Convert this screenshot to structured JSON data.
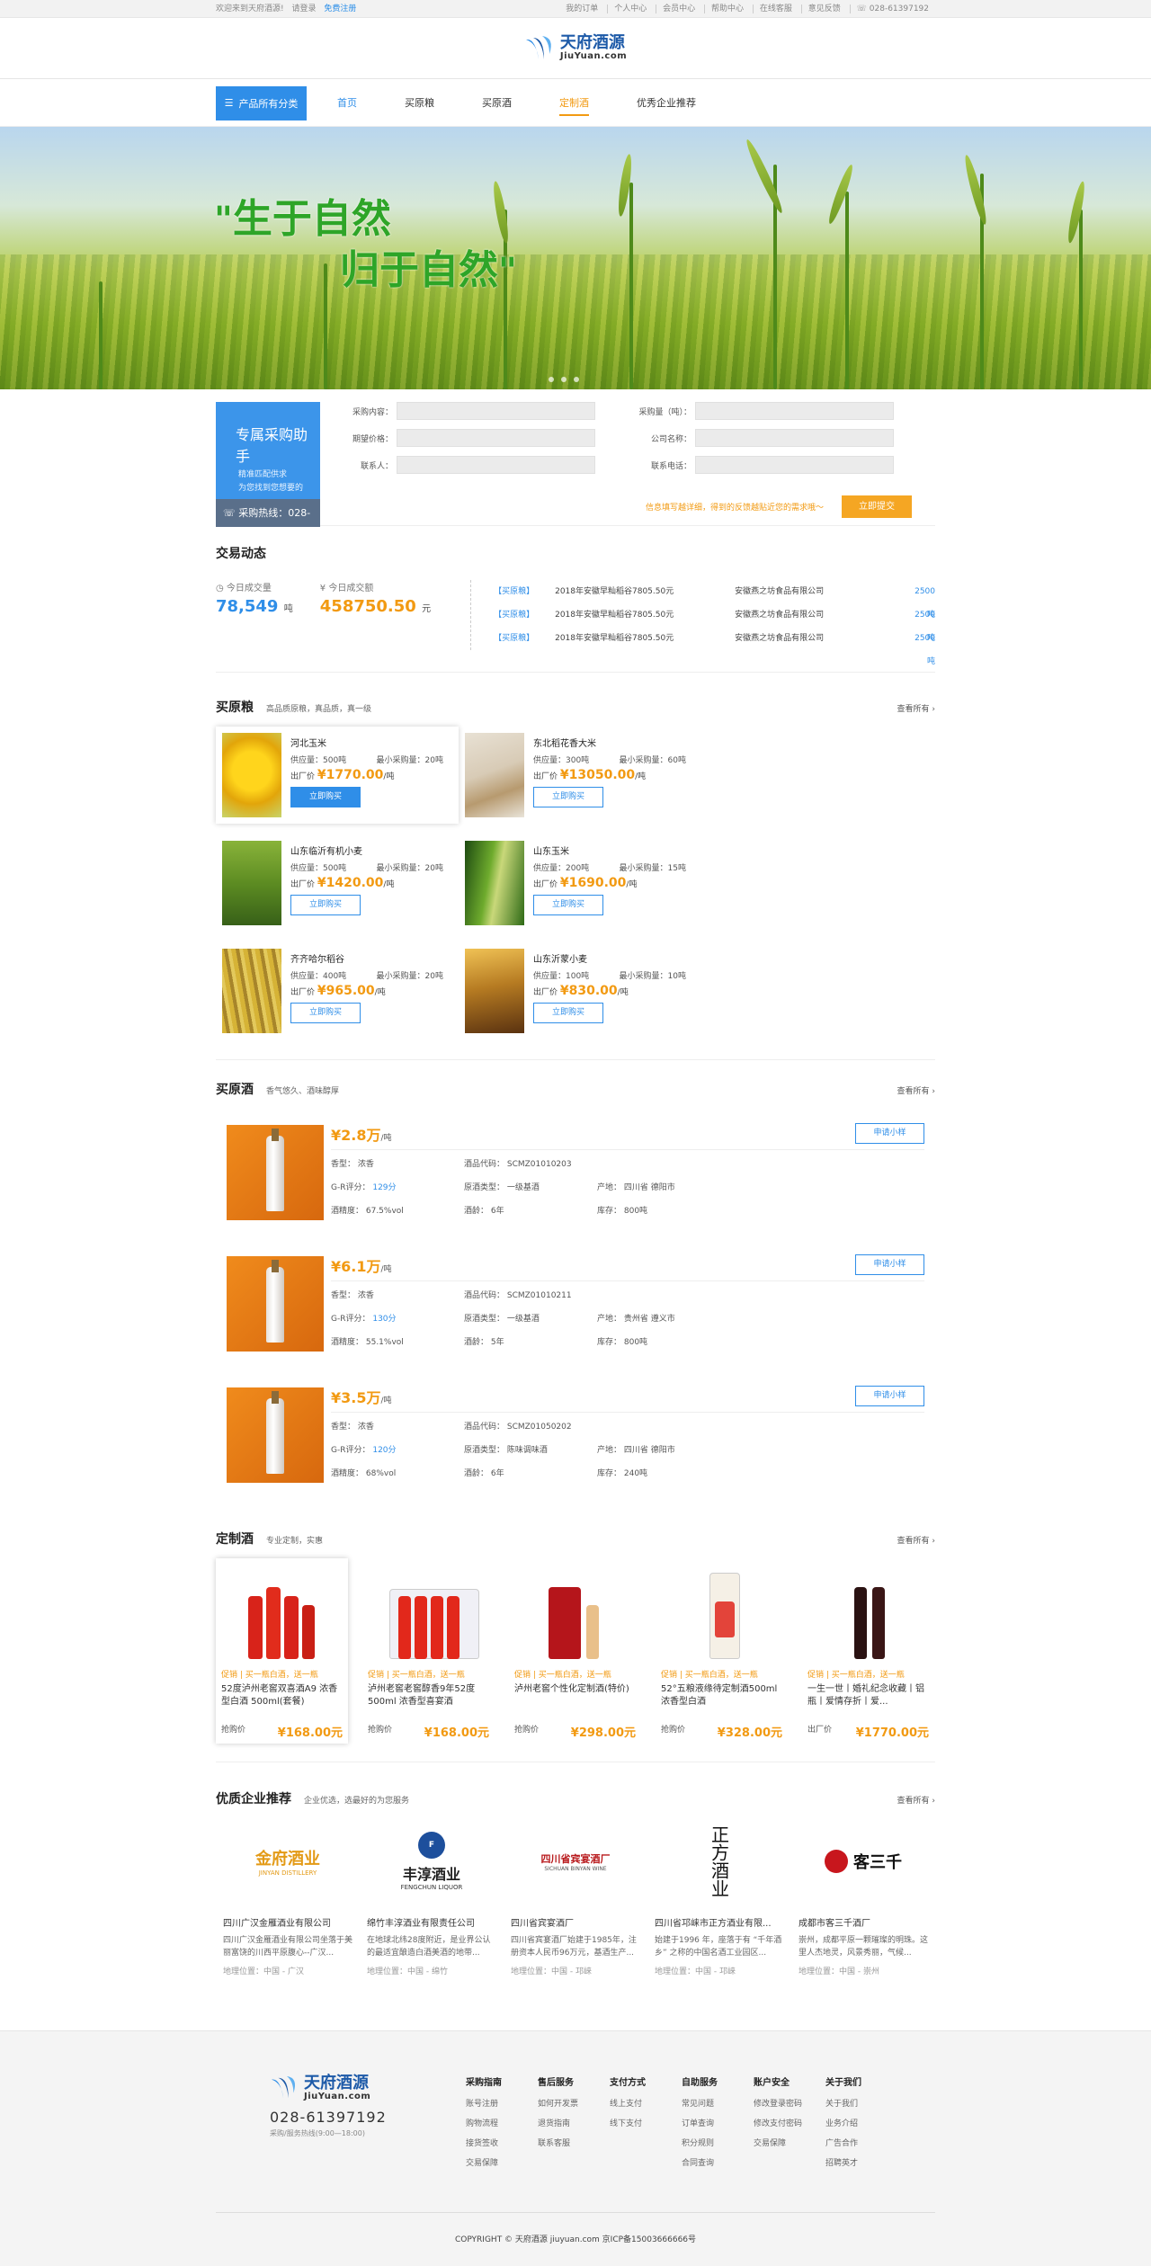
{
  "topbar": {
    "welcome": "欢迎来到天府酒源!",
    "login": "请登录",
    "register": "免费注册",
    "links": [
      "我的订单",
      "个人中心",
      "会员中心",
      "帮助中心",
      "在线客服",
      "意见反馈",
      "028-61397192"
    ]
  },
  "logo": {
    "cn": "天府酒源",
    "en": "JiuYuan.com"
  },
  "nav": {
    "category": "产品所有分类",
    "items": [
      "首页",
      "买原粮",
      "买原酒",
      "定制酒",
      "优秀企业推荐"
    ]
  },
  "banner": {
    "line1": "生于自然",
    "line2": "归于自然",
    "quote_open": "\"",
    "quote_close": "\""
  },
  "assist": {
    "title": "专属采购助手",
    "line1": "精准匹配供求",
    "line2": "为您找到您想要的",
    "hotline": "采购热线：028-61397192",
    "fields": [
      {
        "label": "采购内容：",
        "label2": "采购量（吨）："
      },
      {
        "label": "期望价格：",
        "label2": "公司名称："
      },
      {
        "label": "联系人：",
        "label2": "联系电话："
      }
    ],
    "tip": "信息填写越详细，得到的反馈越贴近您的需求哦～",
    "submit": "立即提交"
  },
  "trade": {
    "title": "交易动态",
    "today_volume_label": "今日成交量",
    "today_volume": "78,549",
    "today_volume_unit": "吨",
    "today_amount_label": "今日成交额",
    "today_amount": "458750.50",
    "today_amount_unit": "元",
    "rows": [
      {
        "tag": "【买原粮】",
        "item": "2018年安徽早籼稻谷7805.50元",
        "company": "安徽燕之坊食品有限公司",
        "qty": "2500吨"
      },
      {
        "tag": "【买原粮】",
        "item": "2018年安徽早籼稻谷7805.50元",
        "company": "安徽燕之坊食品有限公司",
        "qty": "2500吨"
      },
      {
        "tag": "【买原粮】",
        "item": "2018年安徽早籼稻谷7805.50元",
        "company": "安徽燕之坊食品有限公司",
        "qty": "2500吨"
      }
    ]
  },
  "grain": {
    "title": "买原粮",
    "subtitle": "高品质原粮，真品质，真一级",
    "more": "查看所有",
    "items": [
      {
        "name": "河北玉米",
        "supply": "供应量：500吨",
        "min": "最小采购量：20吨",
        "price_label": "出厂价",
        "price": "¥1770.00",
        "unit": "/吨",
        "btn": "立即购买"
      },
      {
        "name": "东北稻花香大米",
        "supply": "供应量：300吨",
        "min": "最小采购量：60吨",
        "price_label": "出厂价",
        "price": "¥13050.00",
        "unit": "/吨",
        "btn": "立即购买"
      },
      {
        "name": "山东临沂有机小麦",
        "supply": "供应量：500吨",
        "min": "最小采购量：20吨",
        "price_label": "出厂价",
        "price": "¥1420.00",
        "unit": "/吨",
        "btn": "立即购买"
      },
      {
        "name": "山东玉米",
        "supply": "供应量：200吨",
        "min": "最小采购量：15吨",
        "price_label": "出厂价",
        "price": "¥1690.00",
        "unit": "/吨",
        "btn": "立即购买"
      },
      {
        "name": "齐齐哈尔稻谷",
        "supply": "供应量：400吨",
        "min": "最小采购量：20吨",
        "price_label": "出厂价",
        "price": "¥965.00",
        "unit": "/吨",
        "btn": "立即购买"
      },
      {
        "name": "山东沂蒙小麦",
        "supply": "供应量：100吨",
        "min": "最小采购量：10吨",
        "price_label": "出厂价",
        "price": "¥830.00",
        "unit": "/吨",
        "btn": "立即购买"
      }
    ]
  },
  "liquor": {
    "title": "买原酒",
    "subtitle": "香气悠久、酒味醇厚",
    "more": "查看所有",
    "items": [
      {
        "price": "¥2.8万",
        "unit": "/吨",
        "apply": "申请小样",
        "c1": [
          "香型：  浓香",
          "G-R评分：",
          "酒精度：  67.5%vol"
        ],
        "score": "129分",
        "c2": [
          "酒品代码：  SCMZ01010203",
          "原酒类型：  一级基酒",
          "酒龄：  6年"
        ],
        "c3": [
          "",
          "产地：  四川省 德阳市",
          "库存：  800吨"
        ]
      },
      {
        "price": "¥6.1万",
        "unit": "/吨",
        "apply": "申请小样",
        "c1": [
          "香型：  浓香",
          "G-R评分：",
          "酒精度：  55.1%vol"
        ],
        "score": "130分",
        "c2": [
          "酒品代码：  SCMZ01010211",
          "原酒类型：  一级基酒",
          "酒龄：  5年"
        ],
        "c3": [
          "",
          "产地：  贵州省 遵义市",
          "库存：  800吨"
        ]
      },
      {
        "price": "¥3.5万",
        "unit": "/吨",
        "apply": "申请小样",
        "c1": [
          "香型：  浓香",
          "G-R评分：",
          "酒精度：  68%vol"
        ],
        "score": "120分",
        "c2": [
          "酒品代码：  SCMZ01050202",
          "原酒类型：  陈味调味酒",
          "酒龄：  6年"
        ],
        "c3": [
          "",
          "产地：  四川省 德阳市",
          "库存：  240吨"
        ]
      }
    ]
  },
  "custom": {
    "title": "定制酒",
    "subtitle": "专业定制，实惠",
    "more": "查看所有",
    "items": [
      {
        "tag": "促销 | 买一瓶白酒，送一瓶",
        "name": "52度泸州老窖双喜酒A9 浓香型白酒 500ml(套餐)",
        "price_label": "抢购价",
        "price": "¥168.00元"
      },
      {
        "tag": "促销 | 买一瓶白酒，送一瓶",
        "name": "泸州老窖老窖醇香9年52度500ml 浓香型喜宴酒",
        "price_label": "抢购价",
        "price": "¥168.00元"
      },
      {
        "tag": "促销 | 买一瓶白酒，送一瓶",
        "name": "泸州老窖个性化定制酒(特价)",
        "price_label": "抢购价",
        "price": "¥298.00元"
      },
      {
        "tag": "促销 | 买一瓶白酒，送一瓶",
        "name": "52°五粮液缘待定制酒500ml 浓香型白酒",
        "price_label": "抢购价",
        "price": "¥328.00元"
      },
      {
        "tag": "促销 | 买一瓶白酒，送一瓶",
        "name": "一生一世丨婚礼纪念收藏丨铝瓶丨爱情存折丨爱...",
        "price_label": "出厂价",
        "price": "¥1770.00元"
      }
    ]
  },
  "enterprise": {
    "title": "优质企业推荐",
    "subtitle": "企业优选，选最好的为您服务",
    "more": "查看所有",
    "items": [
      {
        "logo": "金府酒业",
        "logo_en": "JINYAN DISTILLERY",
        "name": "四川广汉金雁酒业有限公司",
        "desc": "四川广汉金雁酒业有限公司坐落于美丽富饶的川西平原腹心--广汉...",
        "addr": "地理位置：中国 - 广汉"
      },
      {
        "logo": "丰淳酒业",
        "logo_en": "FENGCHUN LIQUOR",
        "name": "绵竹丰淳酒业有限责任公司",
        "desc": "在地球北纬28度附近，是业界公认的最适宜酿造白酒美酒的地带...",
        "addr": "地理位置：中国 - 绵竹"
      },
      {
        "logo": "四川省宾宴酒厂",
        "logo_en": "SICHUAN BINYAN WINE",
        "name": "四川省宾宴酒厂",
        "desc": "四川省宾宴酒厂始建于1985年，注册资本人民币96万元，基酒生产...",
        "addr": "地理位置：中国 - 邛崃"
      },
      {
        "logo": "正方酒业",
        "logo_en": "",
        "name": "四川省邛崃市正方酒业有限...",
        "desc": "始建于1996 年，座落于有 “千年酒乡” 之称的中国名酒工业园区...",
        "addr": "地理位置：中国 - 邛崃"
      },
      {
        "logo": "客三千",
        "logo_en": "",
        "name": "成都市客三千酒厂",
        "desc": "崇州，成都平原一颗璀璨的明珠。这里人杰地灵，风景秀丽，气候...",
        "addr": "地理位置：中国 - 崇州"
      }
    ]
  },
  "footer": {
    "tel": "028-61397192",
    "hours": "采购/服务热线(9:00—18:00)",
    "cols": [
      {
        "title": "采购指南",
        "items": [
          "账号注册",
          "购物流程",
          "接货签收",
          "交易保障"
        ]
      },
      {
        "title": "售后服务",
        "items": [
          "如何开发票",
          "退货指南",
          "联系客服"
        ]
      },
      {
        "title": "支付方式",
        "items": [
          "线上支付",
          "线下支付"
        ]
      },
      {
        "title": "自助服务",
        "items": [
          "常见问题",
          "订单查询",
          "积分规则",
          "合同查询"
        ]
      },
      {
        "title": "账户安全",
        "items": [
          "修改登录密码",
          "修改支付密码",
          "交易保障"
        ]
      },
      {
        "title": "关于我们",
        "items": [
          "关于我们",
          "业务介绍",
          "广告合作",
          "招聘英才"
        ]
      }
    ],
    "copyright": "COPYRIGHT © 天府酒源 jiuyuan.com 京ICP备15003666666号"
  },
  "colors": {
    "primary": "#2f8ee8",
    "accent": "#f29a12",
    "green": "#2ea528"
  }
}
